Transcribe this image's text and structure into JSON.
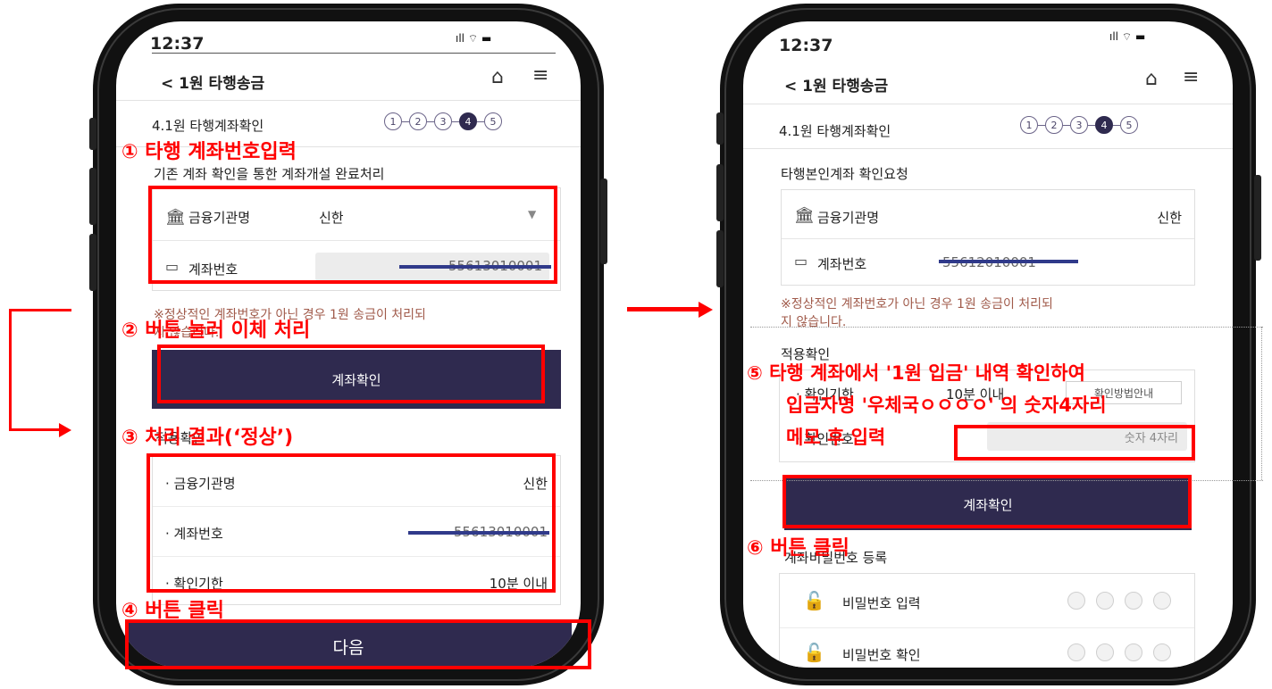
{
  "left": {
    "status": {
      "time": "12:37"
    },
    "header": {
      "title": "< 1원 타행송금"
    },
    "step_title": "4.1원 타행계좌확인",
    "steps": [
      "1",
      "2",
      "3",
      "4",
      "5"
    ],
    "desc": "기존 계좌 확인을 통한 계좌개설 완료처리",
    "bank_label": "금융기관명",
    "bank_value": "신한",
    "account_label": "계좌번호",
    "account_value": "55613010001",
    "notice_line1": "※정상적인 계좌번호가 아닌 경우 1원 송금이 처리되",
    "notice_line2": "지 않습니다.",
    "confirm_button": "계좌확인",
    "apply_title": "적용확인",
    "result_bank_label": "금융기관명",
    "result_bank_value": "신한",
    "result_account_label": "계좌번호",
    "result_account_value": "55613010001",
    "result_deadline_label": "확인기한",
    "result_deadline_value": "10분 이내",
    "next_button": "다음"
  },
  "right": {
    "status": {
      "time": "12:37"
    },
    "header": {
      "title": "< 1원 타행송금"
    },
    "step_title": "4.1원 타행계좌확인",
    "steps": [
      "1",
      "2",
      "3",
      "4",
      "5"
    ],
    "request_title": "타행본인계좌 확인요청",
    "bank_label": "금융기관명",
    "bank_value": "신한",
    "account_label": "계좌번호",
    "account_value": "55612010001",
    "notice_line1": "※정상적인 계좌번호가 아닌 경우 1원 송금이 처리되",
    "notice_line2": "지 않습니다.",
    "apply_title": "적용확인",
    "deadline_label": "확인기한",
    "deadline_value": "10분 이내",
    "method_guide": "확인방법안내",
    "verify_label": "확인번호",
    "verify_placeholder": "숫자 4자리",
    "confirm_button": "계좌확인",
    "pw_title": "계좌비밀번호 등록",
    "pw_input": "비밀번호 입력",
    "pw_confirm": "비밀번호 확인"
  },
  "annotations": {
    "a1": "① 타행 계좌번호입력",
    "a2": "② 버튼 눌러 이체 처리",
    "a3": "③ 처리 결과(‘정상’)",
    "a4": "④ 버튼 클릭",
    "a5_line1": "⑤ 타행 계좌에서 '1원 입금' 내역 확인하여",
    "a5_line2": "입금자명 '우체국ㅇㅇㅇㅇ' 의 숫자4자리",
    "a5_line3": "메모 후 입력",
    "a6": "⑥ 버튼 클릭"
  },
  "colors": {
    "navy": "#2f2a4f",
    "annotation_red": "#ff0000",
    "mask": "#303a8a"
  }
}
